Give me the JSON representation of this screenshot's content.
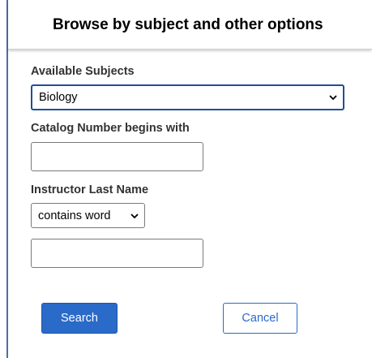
{
  "header": {
    "title": "Browse by subject and other options"
  },
  "form": {
    "subjects_label": "Available Subjects",
    "subject_selected": "Biology",
    "catalog_label": "Catalog Number begins with",
    "catalog_value": "",
    "instructor_label": "Instructor Last Name",
    "instructor_match_selected": "contains word",
    "instructor_value": ""
  },
  "buttons": {
    "search_label": "Search",
    "cancel_label": "Cancel"
  },
  "colors": {
    "primary": "#2a6ac9",
    "focus_border": "#1f4e99",
    "label_text": "#333333"
  },
  "icons": {
    "select_chevron": "chevron-down-icon"
  }
}
